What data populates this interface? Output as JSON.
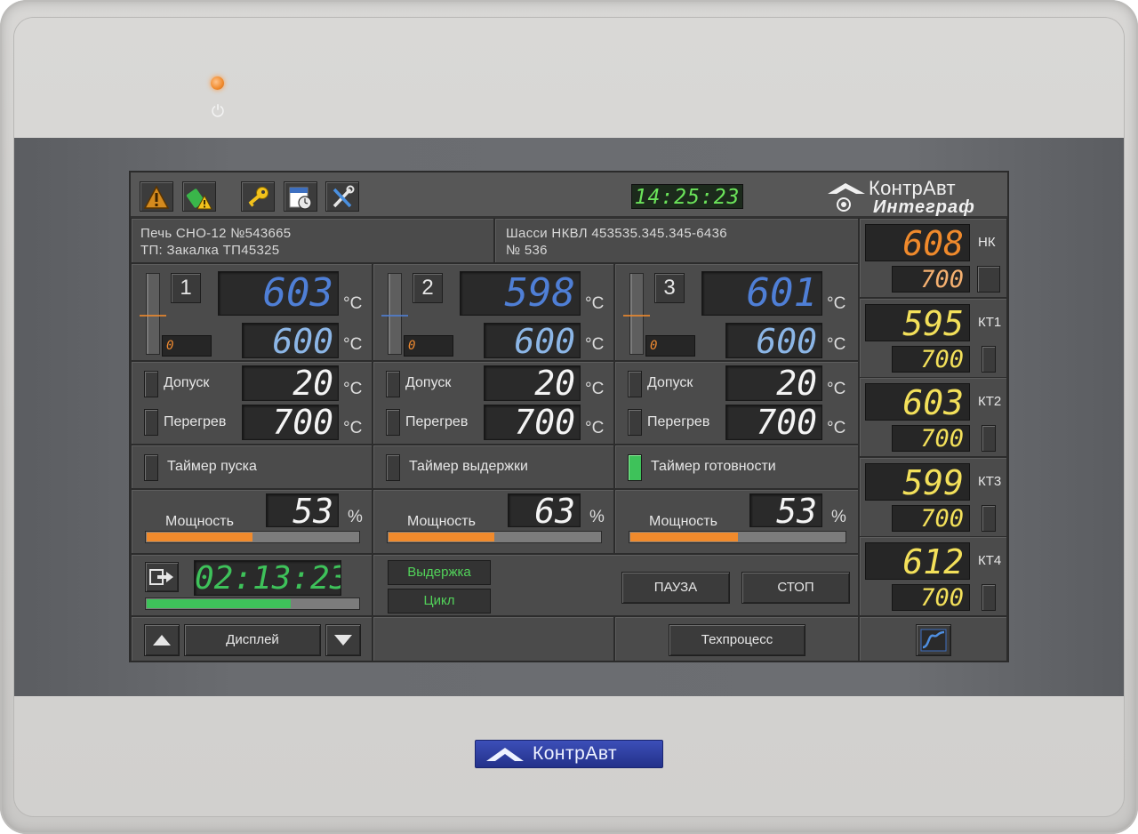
{
  "colors": {
    "display_blue": "#4f7fd6",
    "display_light_blue": "#8cb6e6",
    "nk_orange": "#f08a2c",
    "kt_yellow": "#f3e05a",
    "indicator_green": "#3ec25a",
    "clock_green": "#6be35a",
    "brand_blue": "#2d3ea0"
  },
  "device": {
    "power_icon": "power-icon",
    "power_glyph": "⏻",
    "brand_badge": "КонтрАвт"
  },
  "toolbar": {
    "icons": [
      "alarm-warning-icon",
      "usb-warning-icon",
      "key-icon",
      "clock-document-icon",
      "tools-icon"
    ],
    "clock": "14:25:23",
    "logo_line1": "КонтрАвт",
    "logo_line2": "Интеграф"
  },
  "info": {
    "line1": "Печь СНО-12  №543665",
    "line2": "ТП: Закалка ТП45325",
    "line3": "Шасси НКВЛ 453535.345.345-6436",
    "line4": "№ 536"
  },
  "channels": [
    {
      "number": "1",
      "current": "603",
      "current_unit": "°C",
      "setpoint": "600",
      "setpoint_unit": "°C",
      "small": "0",
      "tolerance_label": "Допуск",
      "tolerance": "20",
      "tolerance_unit": "°C",
      "overheat_label": "Перегрев",
      "overheat": "700",
      "overheat_unit": "°C",
      "timer_label": "Таймер пуска",
      "timer_active": false,
      "power_label": "Мощность",
      "power": "53",
      "power_unit": "%",
      "power_fraction": 0.5
    },
    {
      "number": "2",
      "current": "598",
      "current_unit": "°C",
      "setpoint": "600",
      "setpoint_unit": "°C",
      "small": "0",
      "tolerance_label": "Допуск",
      "tolerance": "20",
      "tolerance_unit": "°C",
      "overheat_label": "Перегрев",
      "overheat": "700",
      "overheat_unit": "°C",
      "timer_label": "Таймер выдержки",
      "timer_active": false,
      "power_label": "Мощность",
      "power": "63",
      "power_unit": "%",
      "power_fraction": 0.5
    },
    {
      "number": "3",
      "current": "601",
      "current_unit": "°C",
      "setpoint": "600",
      "setpoint_unit": "°C",
      "small": "0",
      "tolerance_label": "Допуск",
      "tolerance": "20",
      "tolerance_unit": "°C",
      "overheat_label": "Перегрев",
      "overheat": "700",
      "overheat_unit": "°C",
      "timer_label": "Таймер готовности",
      "timer_active": true,
      "power_label": "Мощность",
      "power": "53",
      "power_unit": "%",
      "power_fraction": 0.5
    }
  ],
  "process": {
    "elapsed": "02:13:23",
    "progress_fraction": 0.68,
    "mode_hold": "Выдержка",
    "mode_cycle": "Цикл",
    "pause_label": "ПАУЗА",
    "stop_label": "СТОП"
  },
  "right_column": [
    {
      "name": "НК",
      "value": "608",
      "setpoint": "700",
      "color": "#f08a2c"
    },
    {
      "name": "КТ1",
      "value": "595",
      "setpoint": "700",
      "color": "#f3e05a"
    },
    {
      "name": "КТ2",
      "value": "603",
      "setpoint": "700",
      "color": "#f3e05a"
    },
    {
      "name": "КТ3",
      "value": "599",
      "setpoint": "700",
      "color": "#f3e05a"
    },
    {
      "name": "КТ4",
      "value": "612",
      "setpoint": "700",
      "color": "#f3e05a"
    }
  ],
  "footer": {
    "display_label": "Дисплей",
    "process_label": "Техпроцесс",
    "trend_icon": "trend-chart-icon"
  }
}
